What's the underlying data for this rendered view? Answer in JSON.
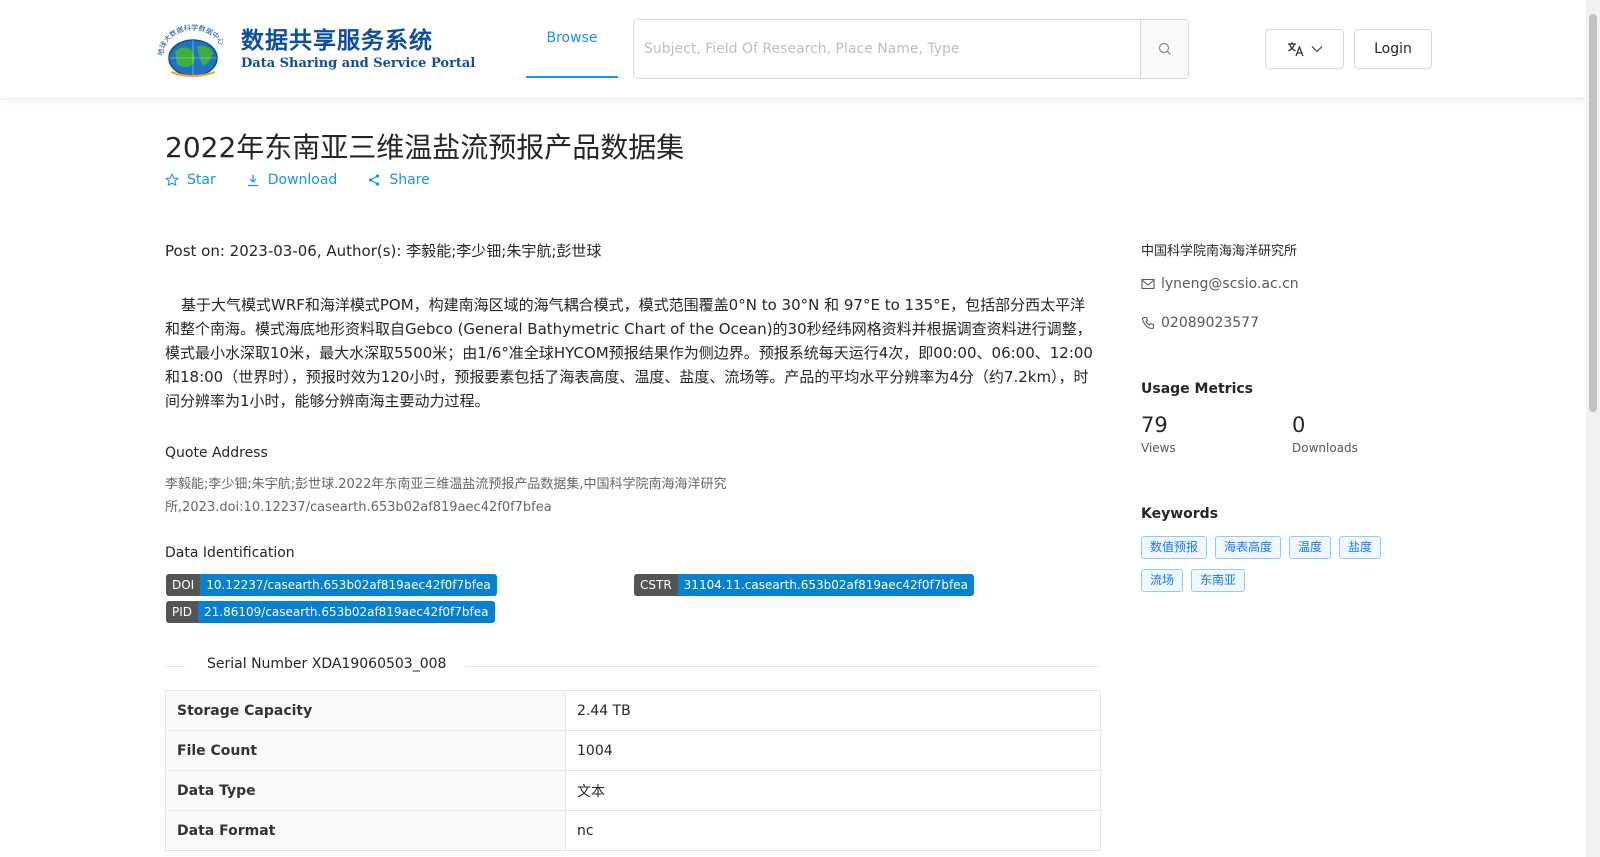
{
  "header": {
    "logo_cn": "数据共享服务系统",
    "logo_en": "Data Sharing and Service Portal",
    "logo_ring_text": "地球大数据科学数据中心",
    "nav_browse": "Browse",
    "search_placeholder": "Subject, Field Of Research, Place Name, Type",
    "login_label": "Login"
  },
  "dataset": {
    "title": "2022年东南亚三维温盐流预报产品数据集",
    "actions": {
      "star": "Star",
      "download": "Download",
      "share": "Share"
    },
    "post_on": "Post on: 2023-03-06, Author(s): 李毅能;李少钿;朱宇航;彭世球",
    "abstract": "基于大气模式WRF和海洋模式POM，构建南海区域的海气耦合模式，模式范围覆盖0°N to 30°N 和 97°E to 135°E，包括部分西太平洋和整个南海。模式海底地形资料取自Gebco (General Bathymetric Chart of the Ocean)的30秒经纬网格资料并根据调查资料进行调整，模式最小水深取10米，最大水深取5500米；由1/6°准全球HYCOM预报结果作为侧边界。预报系统每天运行4次，即00:00、06:00、12:00和18:00（世界时），预报时效为120小时，预报要素包括了海表高度、温度、盐度、流场等。产品的平均水平分辨率为4分（约7.2km），时间分辨率为1小时，能够分辨南海主要动力过程。",
    "quote_title": "Quote Address",
    "quote_text": "李毅能;李少钿;朱宇航;彭世球.2022年东南亚三维温盐流预报产品数据集,中国科学院南海海洋研究所,2023.doi:10.12237/casearth.653b02af819aec42f0f7bfea",
    "identification_title": "Data Identification",
    "identifiers": [
      {
        "key": "DOI",
        "value": "10.12237/casearth.653b02af819aec42f0f7bfea"
      },
      {
        "key": "CSTR",
        "value": "31104.11.casearth.653b02af819aec42f0f7bfea"
      },
      {
        "key": "PID",
        "value": "21.86109/casearth.653b02af819aec42f0f7bfea"
      }
    ],
    "serial_number": "Serial Number XDA19060503_008",
    "info_rows": [
      {
        "key": "Storage Capacity",
        "value": "2.44 TB"
      },
      {
        "key": "File Count",
        "value": "1004"
      },
      {
        "key": "Data Type",
        "value": "文本"
      },
      {
        "key": "Data Format",
        "value": "nc"
      }
    ]
  },
  "sidebar": {
    "organization": "中国科学院南海海洋研究所",
    "email": "lyneng@scsio.ac.cn",
    "phone": "02089023577",
    "metrics_title": "Usage Metrics",
    "views_count": "79",
    "views_label": "Views",
    "downloads_count": "0",
    "downloads_label": "Downloads",
    "keywords_title": "Keywords",
    "keywords": [
      "数值预报",
      "海表高度",
      "温度",
      "盐度",
      "流场",
      "东南亚"
    ]
  },
  "colors": {
    "accent": "#1890ff",
    "brand_blue": "#0d4f9e",
    "badge_key_bg": "#555555",
    "badge_value_bg": "#0780d0"
  }
}
